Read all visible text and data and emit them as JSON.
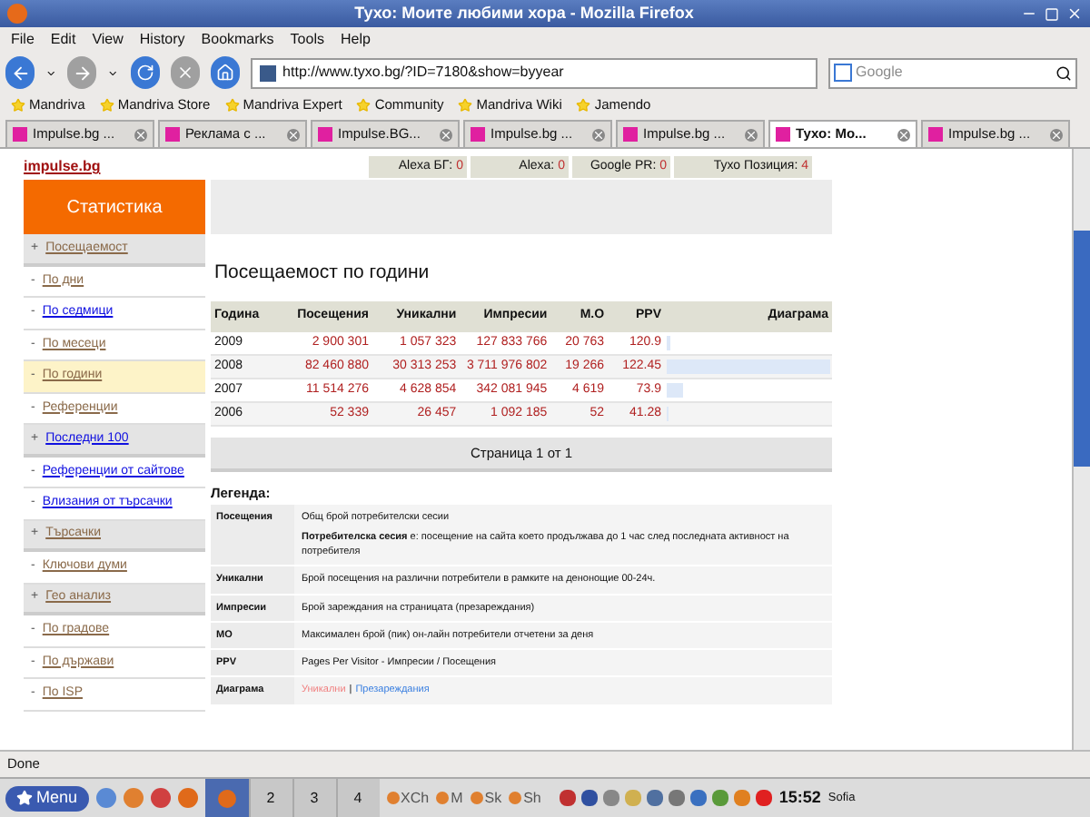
{
  "window": {
    "title": "Тухо: Моите любими хора - Mozilla Firefox"
  },
  "menu": [
    "File",
    "Edit",
    "View",
    "History",
    "Bookmarks",
    "Tools",
    "Help"
  ],
  "address": {
    "value": "http://www.tyxo.bg/?ID=7180&show=byyear"
  },
  "search": {
    "placeholder": "Google"
  },
  "bookmarks": [
    "Mandriva",
    "Mandriva Store",
    "Mandriva Expert",
    "Community",
    "Mandriva Wiki",
    "Jamendo"
  ],
  "tabs": [
    {
      "label": "Impulse.bg ...",
      "selected": false
    },
    {
      "label": "Реклама с ...",
      "selected": false
    },
    {
      "label": "Impulse.BG...",
      "selected": false
    },
    {
      "label": "Impulse.bg ...",
      "selected": false
    },
    {
      "label": "Impulse.bg ...",
      "selected": false
    },
    {
      "label": "Тухо: Мо...",
      "selected": true
    },
    {
      "label": "Impulse.bg ...",
      "selected": false
    }
  ],
  "site_link": "impulse.bg",
  "stats": [
    {
      "label": "Alexa БГ:",
      "value": "0"
    },
    {
      "label": "Alexa:",
      "value": "0"
    },
    {
      "label": "Google PR:",
      "value": "0"
    },
    {
      "label": "Тухо Позиция:",
      "value": "4"
    }
  ],
  "sidebar": {
    "title": "Статистика",
    "items": [
      {
        "kind": "section",
        "marker": "+",
        "label": "Посещаемост",
        "visited": true,
        "selected": false
      },
      {
        "kind": "link",
        "marker": "-",
        "label": "По дни",
        "visited": true,
        "selected": false
      },
      {
        "kind": "link",
        "marker": "-",
        "label": "По седмици",
        "visited": false,
        "selected": false
      },
      {
        "kind": "link",
        "marker": "-",
        "label": "По месеци",
        "visited": true,
        "selected": false
      },
      {
        "kind": "link",
        "marker": "-",
        "label": "По години",
        "visited": true,
        "selected": true
      },
      {
        "kind": "link",
        "marker": "-",
        "label": "Референции",
        "visited": true,
        "selected": false
      },
      {
        "kind": "section",
        "marker": "+",
        "label": "Последни 100",
        "visited": false,
        "selected": false
      },
      {
        "kind": "link",
        "marker": "-",
        "label": "Референции от сайтове",
        "visited": false,
        "selected": false
      },
      {
        "kind": "link",
        "marker": "-",
        "label": "Влизания от търсачки",
        "visited": false,
        "selected": false
      },
      {
        "kind": "section",
        "marker": "+",
        "label": "Търсачки",
        "visited": true,
        "selected": false
      },
      {
        "kind": "link",
        "marker": "-",
        "label": "Ключови думи",
        "visited": true,
        "selected": false
      },
      {
        "kind": "section",
        "marker": "+",
        "label": "Гео анализ",
        "visited": true,
        "selected": false
      },
      {
        "kind": "link",
        "marker": "-",
        "label": "По градове",
        "visited": true,
        "selected": false
      },
      {
        "kind": "link",
        "marker": "-",
        "label": "По държави",
        "visited": true,
        "selected": false
      },
      {
        "kind": "link",
        "marker": "-",
        "label": "По ISP",
        "visited": true,
        "selected": false
      }
    ]
  },
  "heading": "Посещаемост по години",
  "table": {
    "columns": [
      "Година",
      "Посещения",
      "Уникални",
      "Импресии",
      "М.О",
      "PPV",
      "Диаграма"
    ],
    "rows": [
      {
        "cells": [
          "2009",
          "2 900 301",
          "1 057 323",
          "127 833 766",
          "20 763",
          "120.9"
        ],
        "level": 0.02
      },
      {
        "cells": [
          "2008",
          "82 460 880",
          "30 313 253",
          "3 711 976 802",
          "19 266",
          "122.45"
        ],
        "level": 1
      },
      {
        "cells": [
          "2007",
          "11 514 276",
          "4 628 854",
          "342 081 945",
          "4 619",
          "73.9"
        ],
        "level": 0.1
      },
      {
        "cells": [
          "2006",
          "52 339",
          "26 457",
          "1 092 185",
          "52",
          "41.28"
        ],
        "level": 0.01
      }
    ]
  },
  "pagination": "Страница 1 от 1",
  "legend": {
    "title": "Легенда:",
    "rows": [
      {
        "kind": "text",
        "term": "Посещения",
        "text": "Общ брой потребителски сесии",
        "note": "**Потребителска сесия** е: посещение на сайта което продължава до 1 час след последната активност на потребителя"
      },
      {
        "kind": "text",
        "term": "Уникални",
        "text": "Брой посещения на различни потребители в рамките на денонощие 00-24ч."
      },
      {
        "kind": "text",
        "term": "Импресии",
        "text": "Брой зареждания на страницата (презареждания)"
      },
      {
        "kind": "text",
        "term": "МО",
        "text": "Максимален брой (пик) он-лайн потребители отчетени за деня"
      },
      {
        "kind": "text",
        "term": "PPV",
        "text": "Pages Per Visitor - Импресии / Посещения"
      },
      {
        "kind": "links",
        "term": "Диаграма",
        "links": [
          {
            "label": "Уникални",
            "color": "#f08080"
          },
          {
            "label": "Презареждания",
            "color": "#3a7fe0"
          }
        ],
        "separator": "|"
      }
    ]
  },
  "status_bar": "Done",
  "taskbar": {
    "menu": "Menu",
    "pager": [
      {
        "kind": "icon",
        "selected": true
      },
      {
        "kind": "number",
        "label": "2",
        "selected": false
      },
      {
        "kind": "number",
        "label": "3",
        "selected": false
      },
      {
        "kind": "number",
        "label": "4",
        "selected": false
      }
    ],
    "tasks": [
      "XCh",
      "M",
      "Sk",
      "Sh"
    ],
    "clock": "15:52",
    "city": "Sofia"
  }
}
